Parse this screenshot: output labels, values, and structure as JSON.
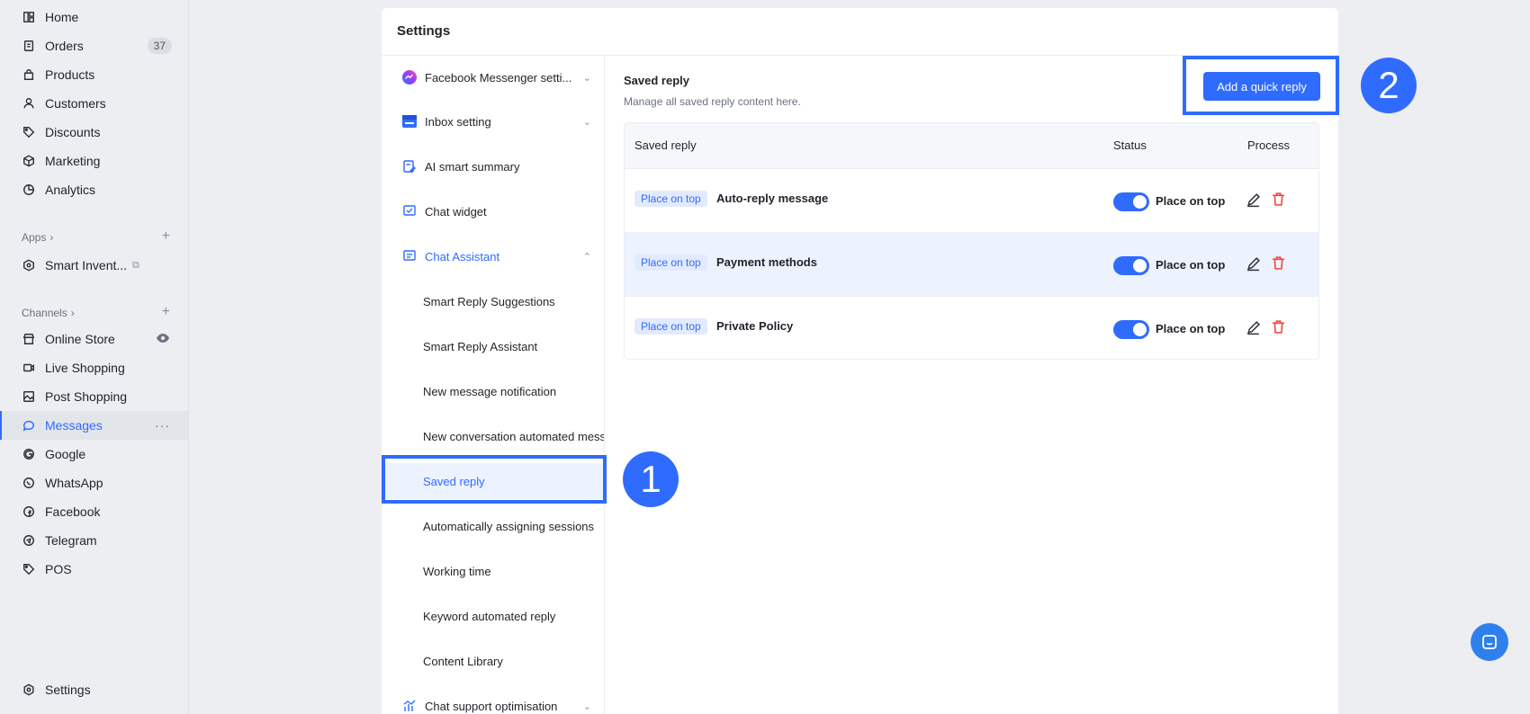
{
  "sidebar": {
    "home": "Home",
    "orders": "Orders",
    "orders_count": "37",
    "products": "Products",
    "customers": "Customers",
    "discounts": "Discounts",
    "marketing": "Marketing",
    "analytics": "Analytics",
    "apps_label": "Apps",
    "smart_inventory": "Smart Invent...",
    "channels_label": "Channels",
    "online_store": "Online Store",
    "live_shopping": "Live Shopping",
    "post_shopping": "Post Shopping",
    "messages": "Messages",
    "google": "Google",
    "whatsapp": "WhatsApp",
    "facebook": "Facebook",
    "telegram": "Telegram",
    "pos": "POS",
    "settings": "Settings"
  },
  "settings": {
    "title": "Settings",
    "menu": {
      "facebook_messenger": "Facebook Messenger setti...",
      "inbox_setting": "Inbox setting",
      "ai_summary": "AI smart summary",
      "chat_widget": "Chat widget",
      "chat_assistant": "Chat Assistant",
      "smart_reply_suggestions": "Smart Reply Suggestions",
      "smart_reply_assistant": "Smart Reply Assistant",
      "new_message_notification": "New message notification",
      "new_conversation": "New conversation automated mess",
      "saved_reply": "Saved reply",
      "auto_assign": "Automatically assigning sessions",
      "working_time": "Working time",
      "keyword_reply": "Keyword automated reply",
      "content_library": "Content Library",
      "chat_support": "Chat support optimisation"
    }
  },
  "content": {
    "title": "Saved reply",
    "subtitle": "Manage all saved reply content here.",
    "add_button": "Add a quick reply",
    "table": {
      "headers": {
        "name": "Saved reply",
        "status": "Status",
        "process": "Process"
      },
      "rows": [
        {
          "tag": "Place on top",
          "name": "Auto-reply message",
          "status": "Place on top"
        },
        {
          "tag": "Place on top",
          "name": "Payment methods",
          "status": "Place on top"
        },
        {
          "tag": "Place on top",
          "name": "Private Policy",
          "status": "Place on top"
        }
      ]
    }
  },
  "annotations": {
    "one": "1",
    "two": "2"
  },
  "colors": {
    "accent": "#2f6bff",
    "delete": "#f04438"
  }
}
